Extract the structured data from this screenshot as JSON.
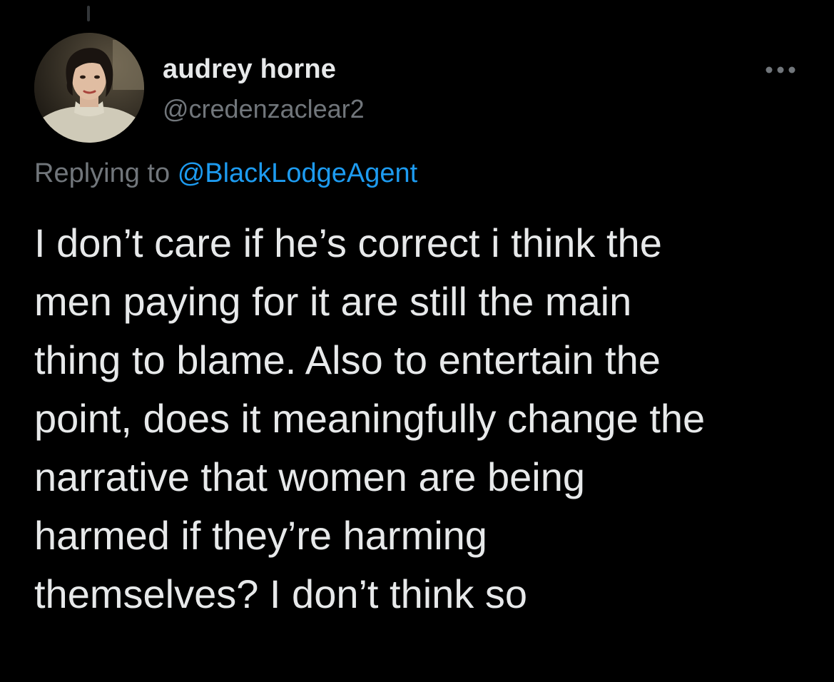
{
  "tweet": {
    "author": {
      "display_name": "audrey horne",
      "handle": "@credenzaclear2",
      "avatar": "profile-photo"
    },
    "more_icon": "more-horizontal-icon",
    "reply_context": {
      "prefix": "Replying to",
      "mention": "@BlackLodgeAgent"
    },
    "text_lines": [
      "I don’t care if he’s correct i think the",
      "men paying for it are still the main",
      "thing to blame. Also to entertain the",
      "point, does it meaningfully change the",
      "narrative that women are being",
      "harmed if they’re harming",
      "themselves? I don’t think so"
    ]
  },
  "colors": {
    "background": "#000000",
    "primary_text": "#e7e9ea",
    "secondary_text": "#71767b",
    "link": "#1d9bf0"
  }
}
